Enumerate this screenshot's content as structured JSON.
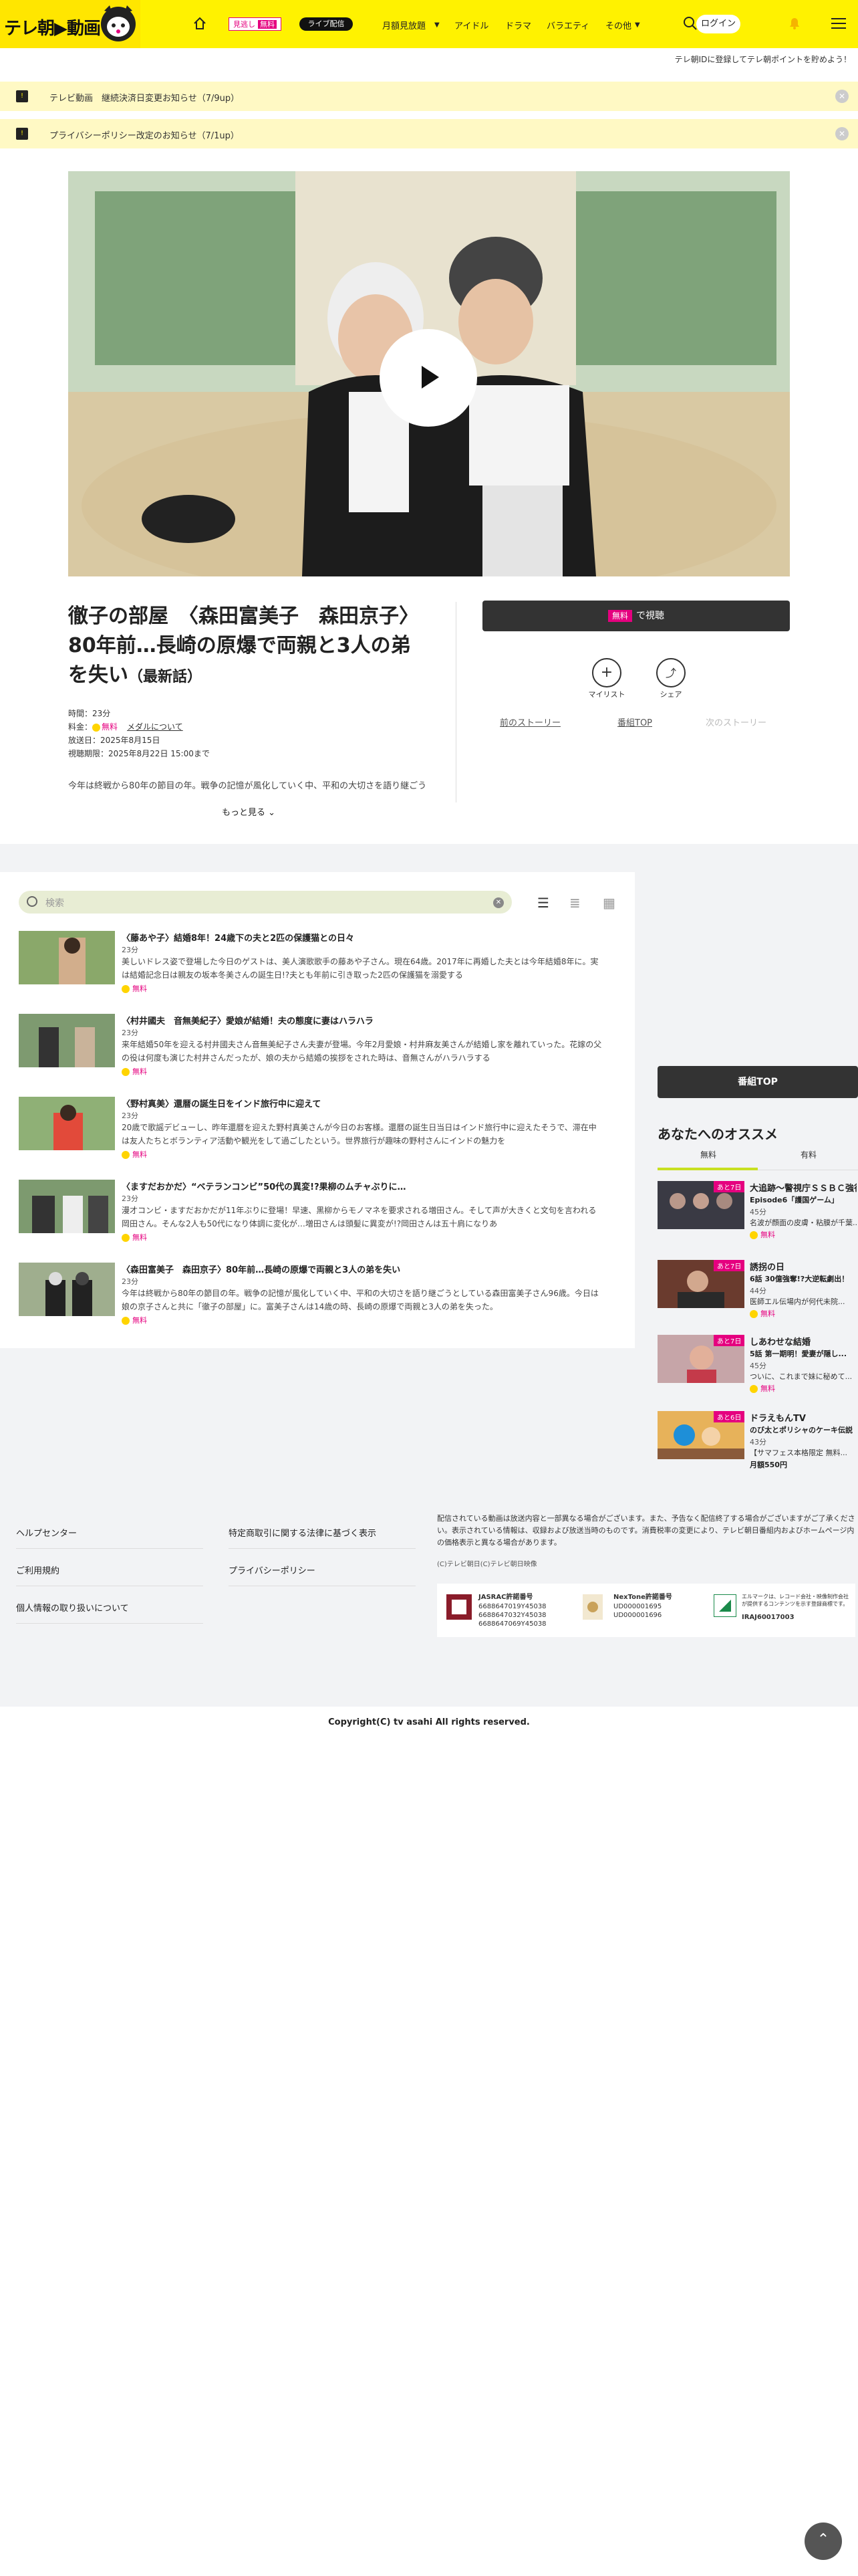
{
  "header": {
    "logo_text": "テレ朝▶動画",
    "nav": {
      "home_icon": "home-icon",
      "chip_miyo": "見逃し",
      "chip_free": "無料",
      "chip_live": "ライブ配信",
      "monthly": "月額見放題",
      "idol": "アイドル",
      "drama": "ドラマ",
      "variety": "バラエティ",
      "other": "その他"
    },
    "login": "ログイン"
  },
  "promo": "テレ朝IDに登録してテレ朝ポイントを貯めよう！",
  "notices": [
    {
      "text": "テレビ動画　継続決済日変更お知らせ（7/9up）"
    },
    {
      "text": "プライバシーポリシー改定のお知らせ（7/1up）"
    }
  ],
  "program": {
    "title_main": "徹子の部屋　〈森田富美子　森田京子〉80年前…長崎の原爆で両親と3人の弟を失い",
    "title_sub": "（最新話）",
    "duration": "時間：23分",
    "price_label": "料金：",
    "price_free": "無料",
    "medal_link": "メダルについて",
    "air_date": "放送日：2025年8月15日",
    "period": "視聴期限：2025年8月22日 15:00まで",
    "desc": "今年は終戦から80年の節目の年。戦争の記憶が風化していく中、平和の大切さを語り継ごう",
    "more": "もっと見る"
  },
  "actions": {
    "watch_free": "無料",
    "watch_label": "で視聴",
    "mylist": "マイリスト",
    "share": "シェア",
    "prev": "前のストーリー",
    "top": "番組TOP",
    "next": "次のストーリー"
  },
  "episodes_search": {
    "placeholder": "検索"
  },
  "episodes": [
    {
      "title": "〈藤あや子〉結婚8年！24歳下の夫と2匹の保護猫との日々",
      "duration": "23分",
      "desc": "美しいドレス姿で登場した今日のゲストは、美人演歌歌手の藤あや子さん。現在64歳。2017年に再婚した夫とは今年結婚8年に。実は結婚記念日は親友の坂本冬美さんの誕生日!?夫とも年前に引き取った2匹の保護猫を溺愛する",
      "free": "無料"
    },
    {
      "title": "〈村井國夫　音無美紀子〉愛娘が結婚！夫の態度に妻はハラハラ",
      "duration": "23分",
      "desc": "来年結婚50年を迎える村井國夫さん音無美紀子さん夫妻が登場。今年2月愛娘・村井麻友美さんが結婚し家を離れていった。花嫁の父の役は何度も演じた村井さんだったが、娘の夫から結婚の挨拶をされた時は、音無さんがハラハラする",
      "free": "無料"
    },
    {
      "title": "〈野村真美〉還暦の誕生日をインド旅行中に迎えて",
      "duration": "23分",
      "desc": "20歳で歌謡デビューし、昨年還暦を迎えた野村真美さんが今日のお客様。還暦の誕生日当日はインド旅行中に迎えたそうで、滞在中は友人たちとボランティア活動や観光をして過ごしたという。世界旅行が趣味の野村さんにインドの魅力を",
      "free": "無料"
    },
    {
      "title": "〈ますだおかだ〉“ベテランコンビ”50代の異変!?果柳のムチャぶりに…",
      "duration": "23分",
      "desc": "漫才コンビ・ますだおかだが11年ぶりに登場！早速、黒柳からモノマネを要求される増田さん。そして声が大きくと文句を言われる岡田さん。そんな2人も50代になり体調に変化が…増田さんは頭髪に異変が!?岡田さんは五十肩になりあ",
      "free": "無料"
    },
    {
      "title": "〈森田富美子　森田京子〉80年前…長崎の原爆で両親と3人の弟を失い",
      "duration": "23分",
      "desc": "今年は終戦から80年の節目の年。戦争の記憶が風化していく中、平和の大切さを語り継ごうとしている森田富美子さん96歳。今日は娘の京子さんと共に「徹子の部屋」に。富美子さんは14歳の時、長崎の原爆で両親と3人の弟を失った。",
      "free": "無料"
    }
  ],
  "sidebar": {
    "bangumi_top": "番組TOP",
    "rec_title": "あなたへのオススメ",
    "tab_free": "無料",
    "tab_paid": "有料",
    "items": [
      {
        "badge": "あと7日",
        "title": "大追跡〜警視庁ＳＳＢＣ強行犯係〜",
        "sub": "Episode6「護国ゲーム」",
        "duration": "45分",
        "desc": "名波が顔面の皮膚・粘膜が千葉...",
        "free": "無料"
      },
      {
        "badge": "あと7日",
        "title": "誘拐の日",
        "sub": "6話 30億強奪!?大逆転劇出！",
        "duration": "44分",
        "desc": "医師エル伝場内が何代未院...",
        "free": "無料"
      },
      {
        "badge": "あと7日",
        "title": "しあわせな結婚",
        "sub": "5話 第一期明！愛妻が隠し...",
        "duration": "45分",
        "desc": "ついに、これまで妹に秘めて...",
        "free": "無料"
      },
      {
        "badge": "あと6日",
        "title": "ドラえもんTV",
        "sub": "のび太とポリシャのケーキ伝説",
        "duration": "43分",
        "desc": "【サマフェス本格限定 無料...",
        "price": "月額550円"
      }
    ]
  },
  "footer": {
    "links_left": [
      "ヘルプセンター",
      "ご利用規約",
      "個人情報の取り扱いについて"
    ],
    "links_right": [
      "特定商取引に関する法律に基づく表示",
      "プライバシーポリシー"
    ],
    "note": "配信されている動画は放送内容と一部異なる場合がございます。また、予告なく配信終了する場合がございますがご了承ください。表示されている情報は、収録および放送当時のものです。消費税率の変更により、テレビ朝日番組内およびホームページ内の価格表示と異なる場合があります。",
    "small": "(C)テレビ朝日(C)テレビ朝日映像",
    "jasrac_title": "JASRAC許諾番号",
    "jasrac_nums": "6688647019Y45038\n6688647032Y45038\n6688647069Y45038",
    "nextone_title": "NexTone許諾番号",
    "nextone_nums": "UD000001695\nUD000001696",
    "lmark_desc": "エルマークは、レコード会社・映像制作会社が提供するコンテンツを示す登録商標です。",
    "lmark_num": "IRAJ60017003",
    "copyright": "Copyright(C) tv asahi All rights reserved."
  },
  "colors": {
    "brand_yellow": "#fff200",
    "free_pink": "#e5007f",
    "accent_green": "#c8e021"
  }
}
